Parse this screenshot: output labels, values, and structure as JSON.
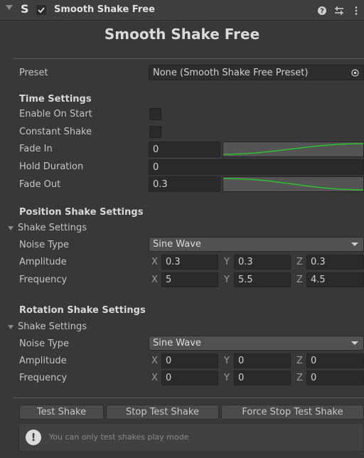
{
  "header": {
    "component_title": "Smooth Shake Free",
    "enabled": true,
    "script_icon": "S"
  },
  "main_title": "Smooth Shake Free",
  "preset": {
    "label": "Preset",
    "value": "None (Smooth Shake Free Preset)"
  },
  "time_settings": {
    "heading": "Time Settings",
    "enable_on_start_label": "Enable On Start",
    "constant_shake_label": "Constant Shake",
    "fade_in_label": "Fade In",
    "fade_in_value": "0",
    "hold_duration_label": "Hold Duration",
    "hold_duration_value": "0",
    "fade_out_label": "Fade Out",
    "fade_out_value": "0.3"
  },
  "position": {
    "heading": "Position Shake Settings",
    "foldout_label": "Shake Settings",
    "noise_label": "Noise Type",
    "noise_value": "Sine Wave",
    "amplitude_label": "Amplitude",
    "amplitude": {
      "x": "0.3",
      "y": "0.3",
      "z": "0.3"
    },
    "frequency_label": "Frequency",
    "frequency": {
      "x": "5",
      "y": "5.5",
      "z": "4.5"
    }
  },
  "rotation": {
    "heading": "Rotation Shake Settings",
    "foldout_label": "Shake Settings",
    "noise_label": "Noise Type",
    "noise_value": "Sine Wave",
    "amplitude_label": "Amplitude",
    "amplitude": {
      "x": "0",
      "y": "0",
      "z": "0"
    },
    "frequency_label": "Frequency",
    "frequency": {
      "x": "0",
      "y": "0",
      "z": "0"
    }
  },
  "axes": {
    "x": "X",
    "y": "Y",
    "z": "Z"
  },
  "buttons": {
    "test_shake": "Test Shake",
    "stop_test_shake": "Stop Test Shake",
    "force_stop_test_shake": "Force Stop Test Shake"
  },
  "help": {
    "icon": "!",
    "text": "You can only test shakes play mode"
  },
  "colors": {
    "curve": "#2fbf2f",
    "background": "#383838"
  }
}
